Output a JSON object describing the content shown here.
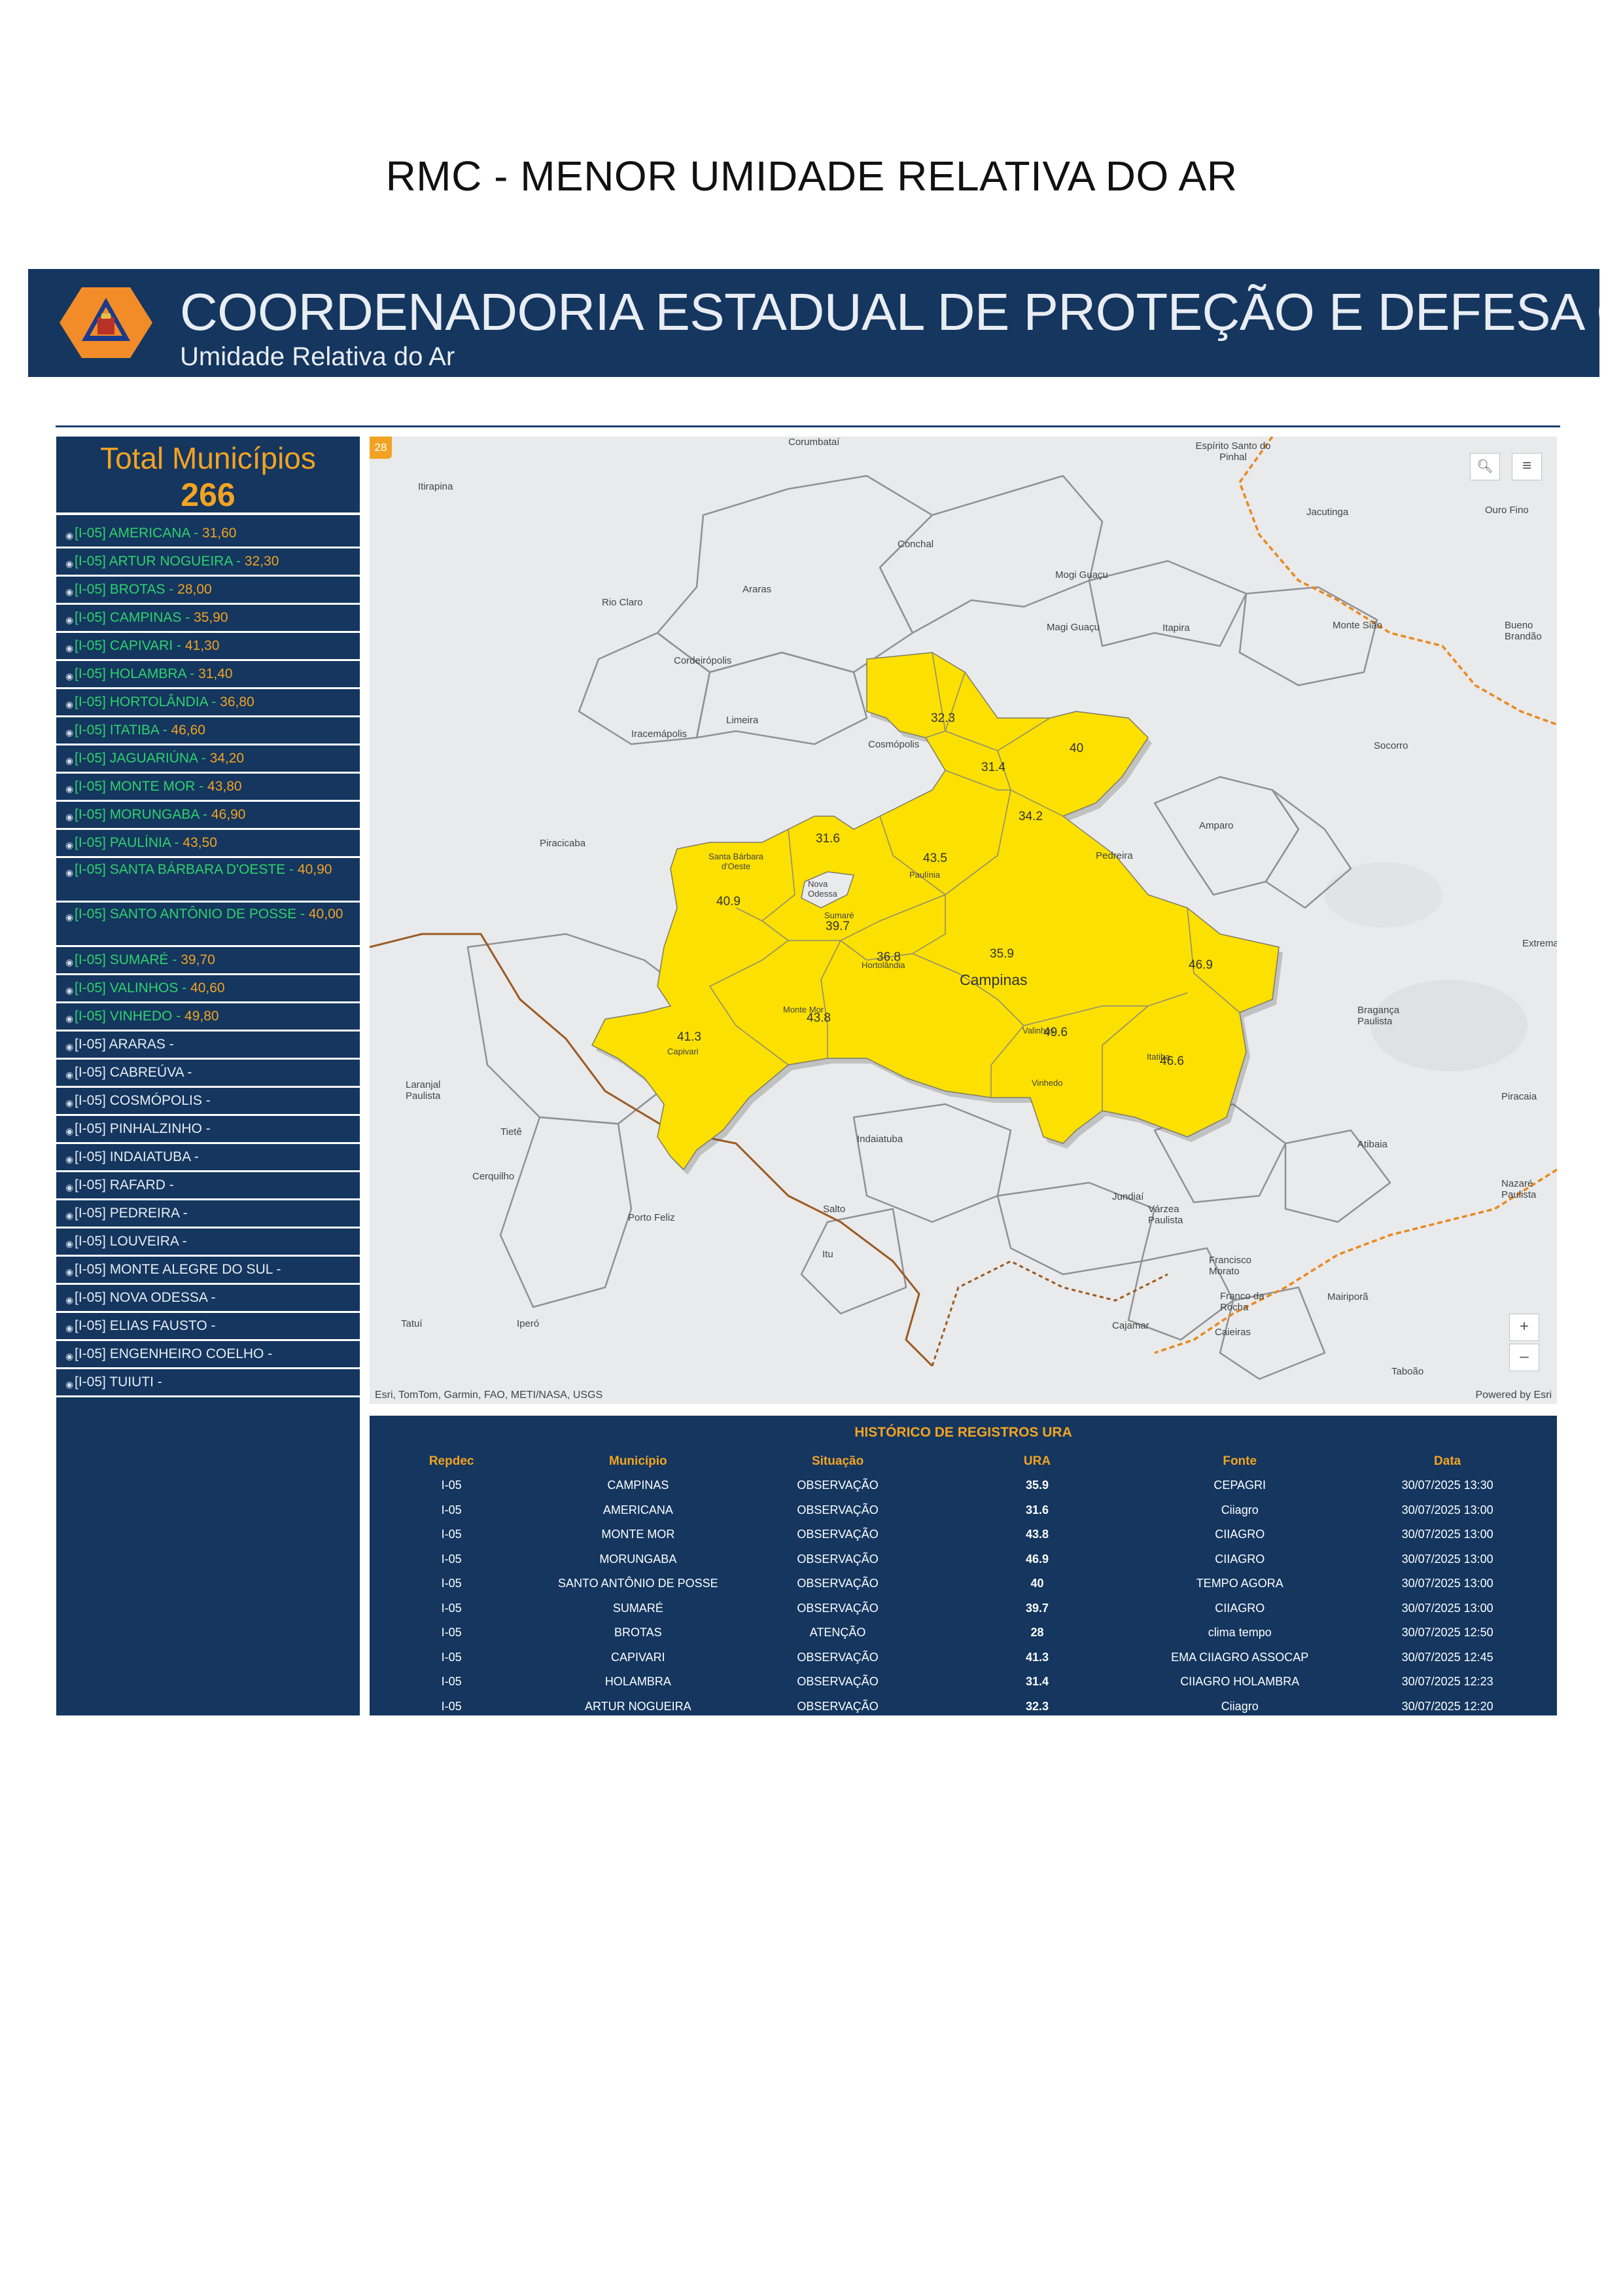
{
  "page": {
    "title": "RMC - MENOR UMIDADE RELATIVA DO AR"
  },
  "banner": {
    "title": "COORDENADORIA ESTADUAL DE PROTEÇÃO E DEFESA CIVIL",
    "subtitle": "Umidade Relativa do Ar",
    "colors": {
      "background": "#14365f",
      "logo_orange": "#f28c28"
    }
  },
  "sidebar": {
    "total_label": "Total Municípios",
    "total_value": "266",
    "items": [
      {
        "name": "[I-05] AMERICANA",
        "value": "31,60"
      },
      {
        "name": "[I-05] ARTUR NOGUEIRA",
        "value": "32,30"
      },
      {
        "name": "[I-05] BROTAS",
        "value": "28,00"
      },
      {
        "name": "[I-05] CAMPINAS",
        "value": "35,90"
      },
      {
        "name": "[I-05] CAPIVARI",
        "value": "41,30"
      },
      {
        "name": "[I-05] HOLAMBRA",
        "value": "31,40"
      },
      {
        "name": "[I-05] HORTOLÂNDIA",
        "value": "36,80"
      },
      {
        "name": "[I-05] ITATIBA",
        "value": "46,60"
      },
      {
        "name": "[I-05] JAGUARIÚNA",
        "value": "34,20"
      },
      {
        "name": "[I-05] MONTE MOR",
        "value": "43,80"
      },
      {
        "name": "[I-05] MORUNGABA",
        "value": "46,90"
      },
      {
        "name": "[I-05] PAULÍNIA",
        "value": "43,50"
      },
      {
        "name": "[I-05] SANTA BÁRBARA D'OESTE",
        "value": "40,90"
      },
      {
        "name": "[I-05] SANTO ANTÔNIO DE POSSE",
        "value": "40,00"
      },
      {
        "name": "[I-05] SUMARÉ",
        "value": "39,70"
      },
      {
        "name": "[I-05] VALINHOS",
        "value": "40,60"
      },
      {
        "name": "[I-05] VINHEDO",
        "value": "49,80"
      },
      {
        "name": "[I-05] ARARAS",
        "value": ""
      },
      {
        "name": "[I-05] CABREÚVA",
        "value": ""
      },
      {
        "name": "[I-05] COSMÓPOLIS",
        "value": ""
      },
      {
        "name": "[I-05] PINHALZINHO",
        "value": ""
      },
      {
        "name": "[I-05] INDAIATUBA",
        "value": ""
      },
      {
        "name": "[I-05] RAFARD",
        "value": ""
      },
      {
        "name": "[I-05] PEDREIRA",
        "value": ""
      },
      {
        "name": "[I-05] LOUVEIRA",
        "value": ""
      },
      {
        "name": "[I-05] MONTE ALEGRE DO SUL",
        "value": ""
      },
      {
        "name": "[I-05] NOVA ODESSA",
        "value": ""
      },
      {
        "name": "[I-05] ELIAS FAUSTO",
        "value": ""
      },
      {
        "name": "[I-05] ENGENHEIRO COELHO",
        "value": ""
      },
      {
        "name": "[I-05] TUIUTI",
        "value": ""
      }
    ]
  },
  "map": {
    "badge": "28",
    "campinas_label": "Campinas",
    "attribution": "Esri, TomTom, Garmin, FAO, METI/NASA, USGS",
    "powered": "Powered by Esri",
    "zoom_in": "+",
    "zoom_out": "–",
    "colors": {
      "region_fill": "#fbe000",
      "state_border": "#e8891e",
      "district_border": "#9a5a22"
    },
    "place_labels": [
      "Itirapina",
      "Corumbataí",
      "Conchal",
      "Espírito Santo do Pinhal",
      "Jacutinga",
      "Ouro Fino",
      "Rio Claro",
      "Araras",
      "Mogi Guaçu",
      "Magi Guaçu",
      "Itapira",
      "Monte Sião",
      "Bueno Brandão",
      "Cordeirópolis",
      "Limeira",
      "Iracemápolis",
      "Cosmópolis",
      "Socorro",
      "Piracicaba",
      "Amparo",
      "Pedreira",
      "Santa Bárbara d'Oeste",
      "Nova Odessa",
      "Sumaré",
      "Hortolândia",
      "Paulínia",
      "Monte Mor",
      "Capivari",
      "Valinhos",
      "Vinhedo",
      "Itatiba",
      "Bragança Paulista",
      "Laranjal Paulista",
      "Tietê",
      "Cerquilho",
      "Indaiatuba",
      "Porto Feliz",
      "Salto",
      "Itu",
      "Jundiaí",
      "Várzea Paulista",
      "Atibaia",
      "Piracaia",
      "Nazaré Paulista",
      "Francisco Morato",
      "Franco da Rocha",
      "Mairiporã",
      "Cajamar",
      "Caieiras",
      "Tatuí",
      "Iperó",
      "Taboão",
      "Extrema"
    ],
    "region_values": [
      "32.3",
      "31.4",
      "40",
      "34.2",
      "31.6",
      "43.5",
      "40.9",
      "39.7",
      "36.8",
      "35.9",
      "46.9",
      "41.3",
      "43.8",
      "49.6",
      "46.6"
    ]
  },
  "history": {
    "title": "HISTÓRICO DE REGISTROS URA",
    "headers": [
      "Repdec",
      "Município",
      "Situação",
      "URA",
      "Fonte",
      "Data"
    ],
    "rows": [
      [
        "I-05",
        "CAMPINAS",
        "OBSERVAÇÃO",
        "35.9",
        "CEPAGRI",
        "30/07/2025 13:30"
      ],
      [
        "I-05",
        "AMERICANA",
        "OBSERVAÇÃO",
        "31.6",
        "Ciiagro",
        "30/07/2025 13:00"
      ],
      [
        "I-05",
        "MONTE MOR",
        "OBSERVAÇÃO",
        "43.8",
        "CIIAGRO",
        "30/07/2025 13:00"
      ],
      [
        "I-05",
        "MORUNGABA",
        "OBSERVAÇÃO",
        "46.9",
        "CIIAGRO",
        "30/07/2025 13:00"
      ],
      [
        "I-05",
        "SANTO ANTÔNIO DE POSSE",
        "OBSERVAÇÃO",
        "40",
        "TEMPO AGORA",
        "30/07/2025 13:00"
      ],
      [
        "I-05",
        "SUMARÉ",
        "OBSERVAÇÃO",
        "39.7",
        "CIIAGRO",
        "30/07/2025 13:00"
      ],
      [
        "I-05",
        "BROTAS",
        "ATENÇÃO",
        "28",
        "clima tempo",
        "30/07/2025 12:50"
      ],
      [
        "I-05",
        "CAPIVARI",
        "OBSERVAÇÃO",
        "41.3",
        "EMA CIIAGRO ASSOCAP",
        "30/07/2025 12:45"
      ],
      [
        "I-05",
        "HOLAMBRA",
        "OBSERVAÇÃO",
        "31.4",
        "CIIAGRO HOLAMBRA",
        "30/07/2025 12:23"
      ],
      [
        "I-05",
        "ARTUR NOGUEIRA",
        "OBSERVAÇÃO",
        "32.3",
        "Ciiagro",
        "30/07/2025 12:20"
      ]
    ]
  }
}
